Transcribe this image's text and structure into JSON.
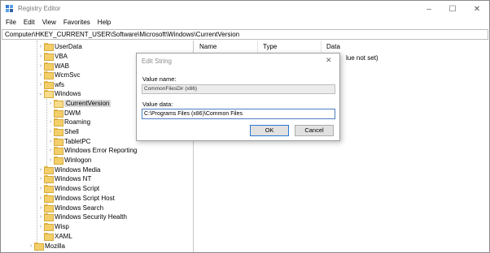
{
  "window": {
    "title": "Registry Editor",
    "controls": {
      "minimize": "–",
      "maximize": "☐",
      "close": "✕"
    }
  },
  "menu": [
    "File",
    "Edit",
    "View",
    "Favorites",
    "Help"
  ],
  "address": "Computer\\HKEY_CURRENT_USER\\Software\\Microsoft\\Windows\\CurrentVersion",
  "tree": [
    {
      "label": "UserData",
      "chevron": "›"
    },
    {
      "label": "VBA",
      "chevron": "›"
    },
    {
      "label": "WAB",
      "chevron": "›"
    },
    {
      "label": "WcmSvc",
      "chevron": "›"
    },
    {
      "label": "wfs",
      "chevron": "›"
    },
    {
      "label": "Windows",
      "chevron": "⌄"
    },
    {
      "label": "CurrentVersion",
      "chevron": "›"
    },
    {
      "label": "DWM",
      "chevron": ""
    },
    {
      "label": "Roaming",
      "chevron": "›"
    },
    {
      "label": "Shell",
      "chevron": "›"
    },
    {
      "label": "TabletPC",
      "chevron": "›"
    },
    {
      "label": "Windows Error Reporting",
      "chevron": "›"
    },
    {
      "label": "Winlogon",
      "chevron": "›"
    },
    {
      "label": "Windows Media",
      "chevron": "›"
    },
    {
      "label": "Windows NT",
      "chevron": "›"
    },
    {
      "label": "Windows Script",
      "chevron": "›"
    },
    {
      "label": "Windows Script Host",
      "chevron": "›"
    },
    {
      "label": "Windows Search",
      "chevron": "›"
    },
    {
      "label": "Windows Security Health",
      "chevron": "›"
    },
    {
      "label": "Wisp",
      "chevron": "›"
    },
    {
      "label": "XAML",
      "chevron": ""
    },
    {
      "label": "Mozilla",
      "chevron": "›"
    }
  ],
  "list": {
    "columns": [
      "Name",
      "Type",
      "Data"
    ],
    "visible_data_fragment": "lue not set)"
  },
  "dialog": {
    "title": "Edit String",
    "close": "✕",
    "value_name_label": "Value name:",
    "value_name": "CommonFilesDir (x86)",
    "value_data_label": "Value data:",
    "value_data": "C:\\Programs  Files (x86)\\Common Files",
    "ok_label": "OK",
    "cancel_label": "Cancel"
  }
}
